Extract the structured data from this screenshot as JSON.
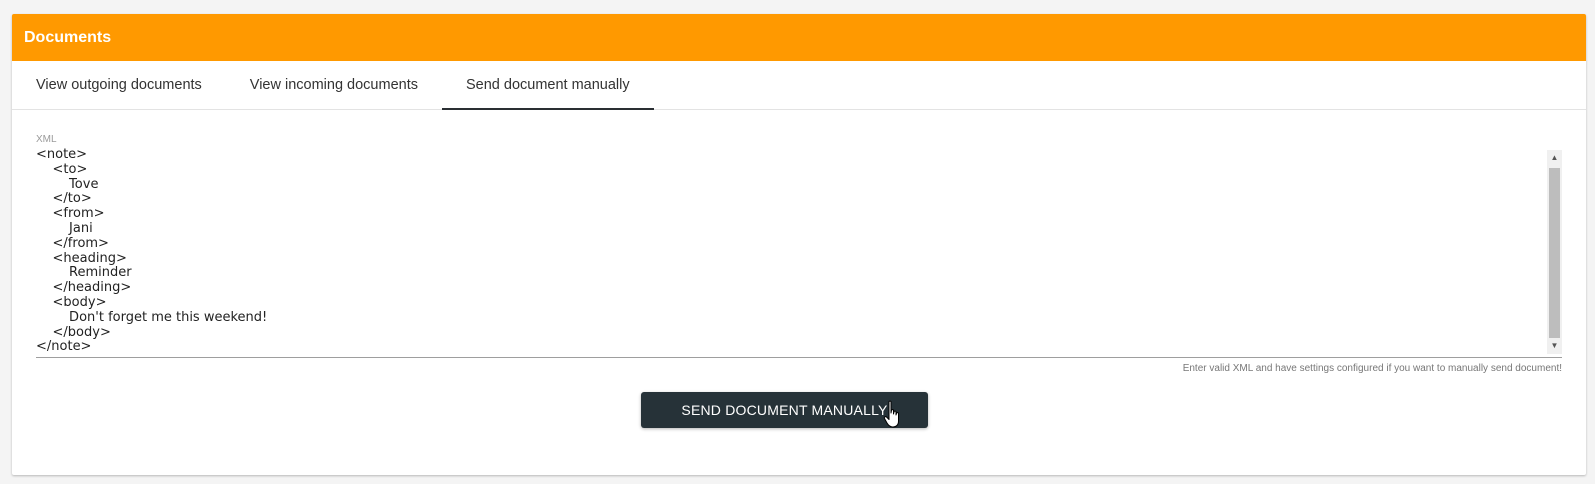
{
  "header": {
    "title": "Documents",
    "color": "#ff9900"
  },
  "tabs": [
    {
      "label": "View outgoing documents"
    },
    {
      "label": "View incoming documents"
    },
    {
      "label": "Send document manually",
      "active": true
    }
  ],
  "xml_field": {
    "label": "XML",
    "value": "<note>\n    <to>\n        Tove\n    </to>\n    <from>\n        Jani\n    </from>\n    <heading>\n        Reminder\n    </heading>\n    <body>\n        Don't forget me this weekend!\n    </body>\n</note>",
    "hint": "Enter valid XML and have settings configured if you want to manually send document!"
  },
  "send_button": {
    "label": "SEND DOCUMENT MANUALLY",
    "color": "#263238"
  },
  "icons": {
    "pointer": "hand-pointer-icon",
    "scroll_up": "arrow-up-icon",
    "scroll_down": "arrow-down-icon"
  }
}
